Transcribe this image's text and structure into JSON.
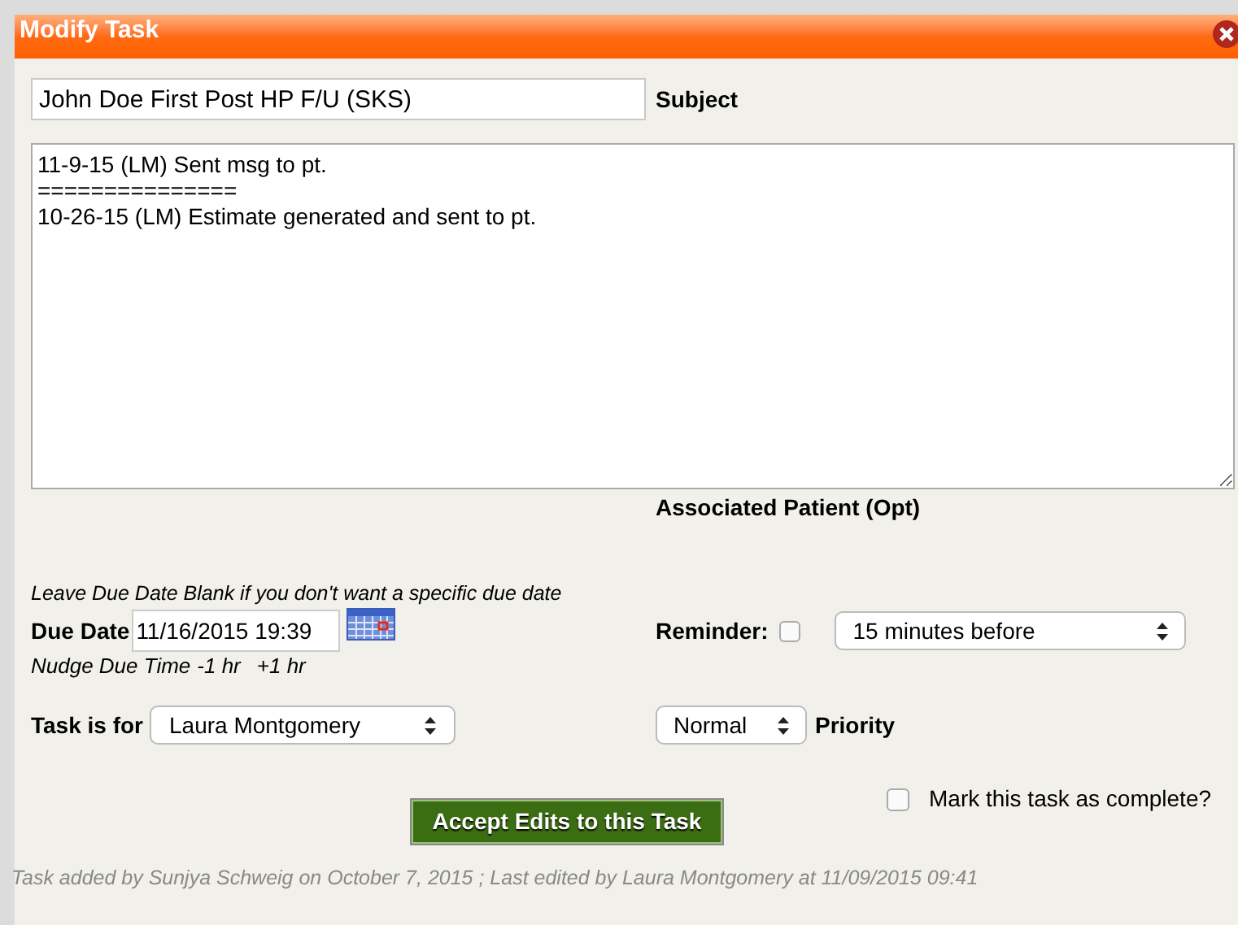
{
  "window": {
    "title": "Modify Task"
  },
  "subject": {
    "value": "John Doe First Post HP F/U (SKS)",
    "label": "Subject"
  },
  "notes": {
    "value": "11-9-15 (LM) Sent msg to pt.\n===============\n10-26-15 (LM) Estimate generated and sent to pt."
  },
  "associated_patient_label": "Associated Patient (Opt)",
  "due_date_hint": "Leave Due Date Blank if you don't want a specific due date",
  "due_date": {
    "label": "Due Date",
    "value": "11/16/2015 19:39"
  },
  "nudge": {
    "label": "Nudge Due Time",
    "minus": "-1 hr",
    "plus": "+1 hr"
  },
  "reminder": {
    "label": "Reminder:",
    "checked": false,
    "option": "15 minutes before"
  },
  "task_for": {
    "label": "Task is for",
    "option": "Laura Montgomery"
  },
  "priority": {
    "option": "Normal",
    "label": "Priority"
  },
  "accept_button": "Accept Edits to this Task",
  "complete": {
    "label": "Mark this task as complete?",
    "checked": false
  },
  "footer": "Task added by Sunjya Schweig on October 7, 2015 ; Last edited by Laura Montgomery at 11/09/2015 09:41"
}
